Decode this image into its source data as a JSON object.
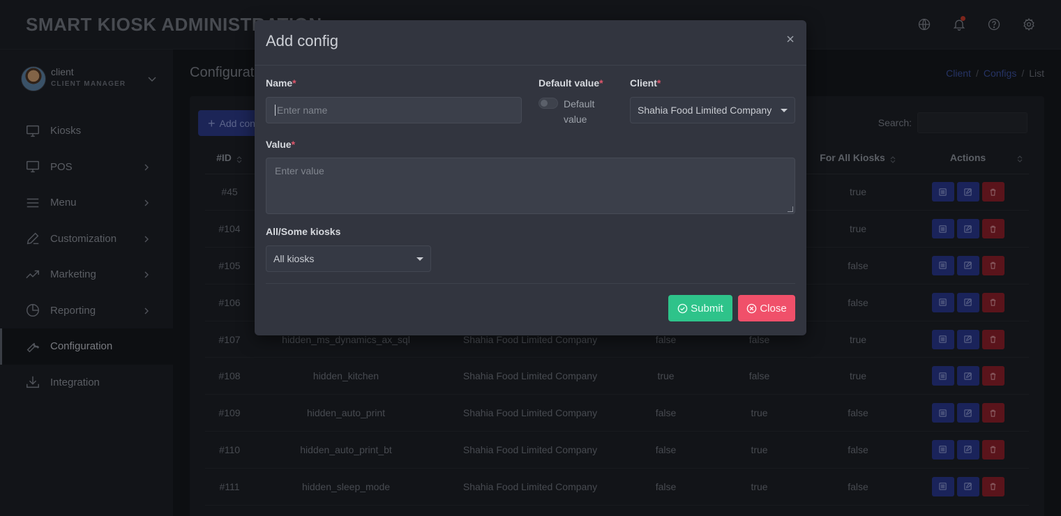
{
  "header": {
    "brand": "SMART KIOSK ADMINISTRATION",
    "icons": [
      "globe-icon",
      "bell-icon",
      "help-icon",
      "gear-icon"
    ]
  },
  "user": {
    "name": "client",
    "role": "CLIENT MANAGER"
  },
  "sidebar": {
    "items": [
      {
        "label": "Kiosks",
        "icon": "monitor-icon",
        "has_submenu": false
      },
      {
        "label": "POS",
        "icon": "monitor-icon",
        "has_submenu": true
      },
      {
        "label": "Menu",
        "icon": "menu-icon",
        "has_submenu": true
      },
      {
        "label": "Customization",
        "icon": "pen-icon",
        "has_submenu": true
      },
      {
        "label": "Marketing",
        "icon": "trend-icon",
        "has_submenu": true
      },
      {
        "label": "Reporting",
        "icon": "pie-chart-icon",
        "has_submenu": true
      },
      {
        "label": "Configuration",
        "icon": "wrench-icon",
        "has_submenu": false,
        "active": true
      },
      {
        "label": "Integration",
        "icon": "download-icon",
        "has_submenu": false
      }
    ]
  },
  "main": {
    "title": "Configurati",
    "breadcrumb": [
      "Client",
      "Configs",
      "List"
    ],
    "add_label": "Add con",
    "search_label": "Search:",
    "columns": [
      "#ID",
      "",
      "",
      "",
      "",
      "For All Kiosks",
      "Actions"
    ],
    "rows": [
      {
        "id": "#45",
        "name": "",
        "client": "",
        "c4": "",
        "c5": "",
        "all": "true"
      },
      {
        "id": "#104",
        "name": "",
        "client": "",
        "c4": "",
        "c5": "",
        "all": "true"
      },
      {
        "id": "#105",
        "name": "",
        "client": "",
        "c4": "",
        "c5": "",
        "all": "false"
      },
      {
        "id": "#106",
        "name": "",
        "client": "",
        "c4": "",
        "c5": "",
        "all": "false"
      },
      {
        "id": "#107",
        "name": "hidden_ms_dynamics_ax_sql",
        "client": "Shahia Food Limited Company",
        "c4": "false",
        "c5": "false",
        "all": "true"
      },
      {
        "id": "#108",
        "name": "hidden_kitchen",
        "client": "Shahia Food Limited Company",
        "c4": "true",
        "c5": "false",
        "all": "true"
      },
      {
        "id": "#109",
        "name": "hidden_auto_print",
        "client": "Shahia Food Limited Company",
        "c4": "false",
        "c5": "true",
        "all": "false"
      },
      {
        "id": "#110",
        "name": "hidden_auto_print_bt",
        "client": "Shahia Food Limited Company",
        "c4": "false",
        "c5": "true",
        "all": "false"
      },
      {
        "id": "#111",
        "name": "hidden_sleep_mode",
        "client": "Shahia Food Limited Company",
        "c4": "false",
        "c5": "true",
        "all": "false"
      }
    ]
  },
  "modal": {
    "title": "Add config",
    "name_label": "Name",
    "name_placeholder": "Enter name",
    "default_label": "Default value",
    "default_toggle_label": "Default value",
    "client_label": "Client",
    "client_value": "Shahia Food Limited Company",
    "value_label": "Value",
    "value_placeholder": "Enter value",
    "kiosks_label": "All/Some kiosks",
    "kiosks_value": "All kiosks",
    "submit_label": "Submit",
    "close_label": "Close",
    "required_mark": "*"
  }
}
